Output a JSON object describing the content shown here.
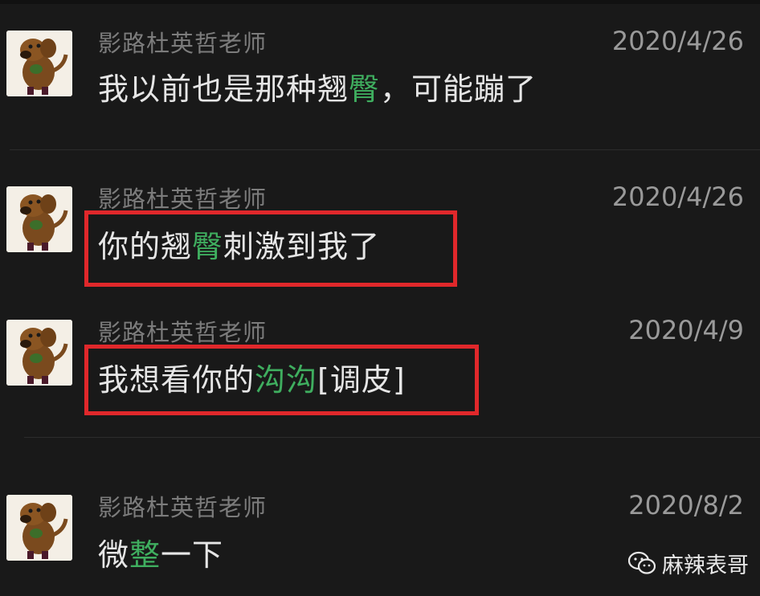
{
  "messages": [
    {
      "sender": "影路杜英哲老师",
      "date": "2020/4/26",
      "segments": [
        {
          "text": "我以前也是那种翘",
          "highlight": false
        },
        {
          "text": "臀",
          "highlight": true
        },
        {
          "text": "，可能蹦了",
          "highlight": false
        }
      ],
      "boxed": false
    },
    {
      "sender": "影路杜英哲老师",
      "date": "2020/4/26",
      "segments": [
        {
          "text": "你的翘",
          "highlight": false
        },
        {
          "text": "臀",
          "highlight": true
        },
        {
          "text": "刺激到我了",
          "highlight": false
        }
      ],
      "boxed": true
    },
    {
      "sender": "影路杜英哲老师",
      "date": "2020/4/9",
      "segments": [
        {
          "text": "我想看你的",
          "highlight": false
        },
        {
          "text": "沟沟",
          "highlight": true
        },
        {
          "text": "[调皮]",
          "highlight": false
        }
      ],
      "boxed": true
    },
    {
      "sender": "影路杜英哲老师",
      "date": "2020/8/2",
      "segments": [
        {
          "text": "微",
          "highlight": false
        },
        {
          "text": "整",
          "highlight": true
        },
        {
          "text": "一下",
          "highlight": false
        }
      ],
      "boxed": false
    }
  ],
  "watermark": {
    "text": "麻辣表哥",
    "icon": "wechat-icon"
  },
  "colors": {
    "background": "#191919",
    "highlight": "#3fae5f",
    "box_border": "#e0282b",
    "sender_text": "#7c7c7c",
    "message_text": "#e6e6e6"
  }
}
